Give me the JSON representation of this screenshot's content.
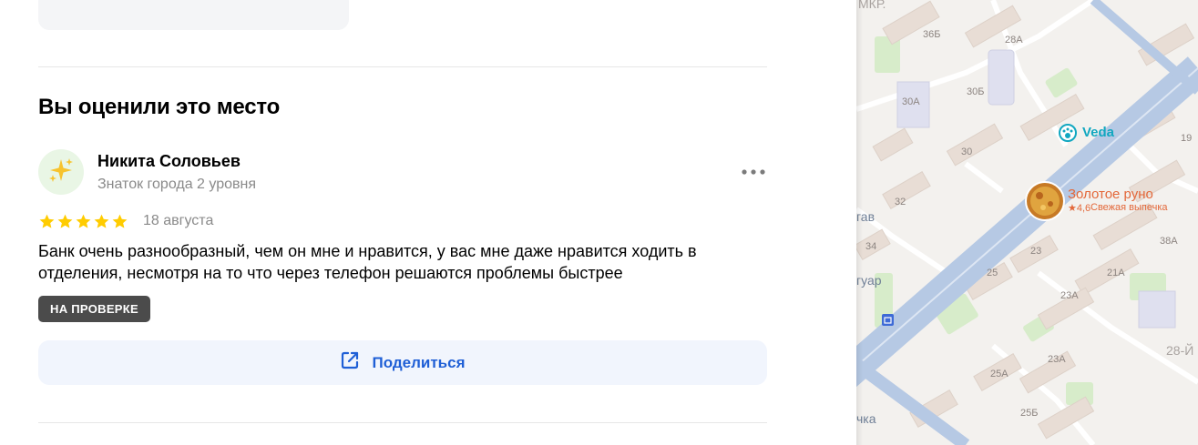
{
  "section": {
    "title": "Вы оценили это место"
  },
  "review": {
    "author_name": "Никита Соловьев",
    "author_level": "Знаток города 2 уровня",
    "rating": 5,
    "date": "18 августа",
    "text": "Банк очень разнообразный, чем он мне и нравится, у вас мне даже нравится ходить в отделения, несмотря на то что через телефон решаются проблемы быстрее",
    "status_badge": "НА ПРОВЕРКЕ",
    "avatar_icon": "sparkles-icon"
  },
  "share": {
    "label": "Поделиться",
    "icon": "share-external-icon"
  },
  "map": {
    "labels": {
      "mkr": "МКР.",
      "b36b": "36Б",
      "b28a": "28А",
      "b30a": "30А",
      "b30b": "30Б",
      "b30": "30",
      "b32": "32",
      "b34": "34",
      "b23": "23",
      "b25": "25",
      "b23a": "23А",
      "b23a2": "23А",
      "b21a": "21А",
      "b25a": "25А",
      "b25b": "25Б",
      "b19": "19",
      "b38a": "38А",
      "street_28": "28-Й",
      "gav": "гав",
      "guar": "гуар",
      "chka": "чка"
    },
    "pois": [
      {
        "name": "Veda",
        "icon": "paw-icon",
        "color": "#11a7c0"
      },
      {
        "name": "Золотое руно",
        "rating": "★4,6",
        "subtitle": "Свежая выпечка",
        "color": "#e3683a",
        "icon": "bakery-photo"
      }
    ],
    "colors": {
      "road": "#b9cce6",
      "building": "#e7ddd6",
      "green": "#d5ecc9"
    }
  }
}
